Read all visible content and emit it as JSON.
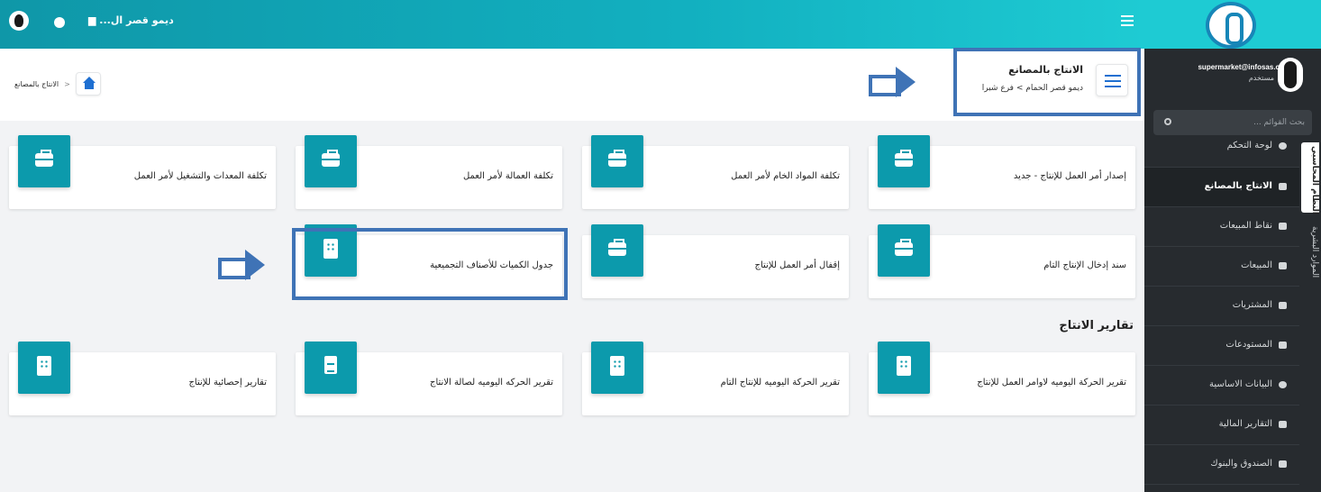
{
  "topbar": {
    "store_label": "ديمو قصر ال..."
  },
  "sidebar": {
    "user_email": "supermarket@infosas.com",
    "user_role": "مستخدم",
    "search_placeholder": "بحث القوائم ...",
    "items": [
      {
        "label": "لوحة التحكم",
        "icon": "info-icon"
      },
      {
        "label": "الانتاج بالمصانع",
        "icon": "factory-icon",
        "active": true
      },
      {
        "label": "نقاط المبيعات",
        "icon": "register-icon"
      },
      {
        "label": "المبيعات",
        "icon": "truck-icon"
      },
      {
        "label": "المشتريات",
        "icon": "money-icon"
      },
      {
        "label": "المستودعات",
        "icon": "archive-icon"
      },
      {
        "label": "البيانات الاساسية",
        "icon": "info-icon"
      },
      {
        "label": "التقارير المالية",
        "icon": "file-icon"
      },
      {
        "label": "الصندوق والبنوك",
        "icon": "money-icon"
      }
    ],
    "tabs": [
      "النظام المحاسبي",
      "الموارد البشرية"
    ]
  },
  "breadcrumb": {
    "current": "الانتاج بالمصانع",
    "separator": ">"
  },
  "page_header": {
    "title": "الانتاج بالمصانع",
    "subtitle_company": "ديمو قصر الحمام",
    "subtitle_sep": ">",
    "subtitle_branch": "فرع شبرا"
  },
  "cards_row1": [
    {
      "label": "إصدار أمر العمل للإنتاج - جديد",
      "icon": "toolbox-icon"
    },
    {
      "label": "تكلفة المواد الخام لأمر العمل",
      "icon": "toolbox-icon"
    },
    {
      "label": "تكلفة العمالة لأمر العمل",
      "icon": "toolbox-icon"
    },
    {
      "label": "تكلفة المعدات والتشغيل لأمر العمل",
      "icon": "toolbox-icon"
    }
  ],
  "cards_row2": [
    {
      "label": "سند إدخال الإنتاج التام",
      "icon": "toolbox-icon"
    },
    {
      "label": "إقفال أمر العمل للإنتاج",
      "icon": "toolbox-icon"
    },
    {
      "label": "جدول الكميات للأصناف التجميعية",
      "icon": "building-icon"
    }
  ],
  "reports_title": "تقارير الانتاج",
  "cards_row3": [
    {
      "label": "تقرير الحركة اليوميه لاوامر العمل للإنتاج",
      "icon": "building-icon"
    },
    {
      "label": "تقرير الحركة اليوميه للإنتاج التام",
      "icon": "building-icon"
    },
    {
      "label": "تقرير الحركه اليوميه لصالة الانتاج",
      "icon": "document-icon"
    },
    {
      "label": "تقارير إحصائية للإنتاج",
      "icon": "building-icon"
    }
  ],
  "colors": {
    "accent": "#0c9aac",
    "highlight": "#3f73b6",
    "sidebar": "#272b2f"
  }
}
